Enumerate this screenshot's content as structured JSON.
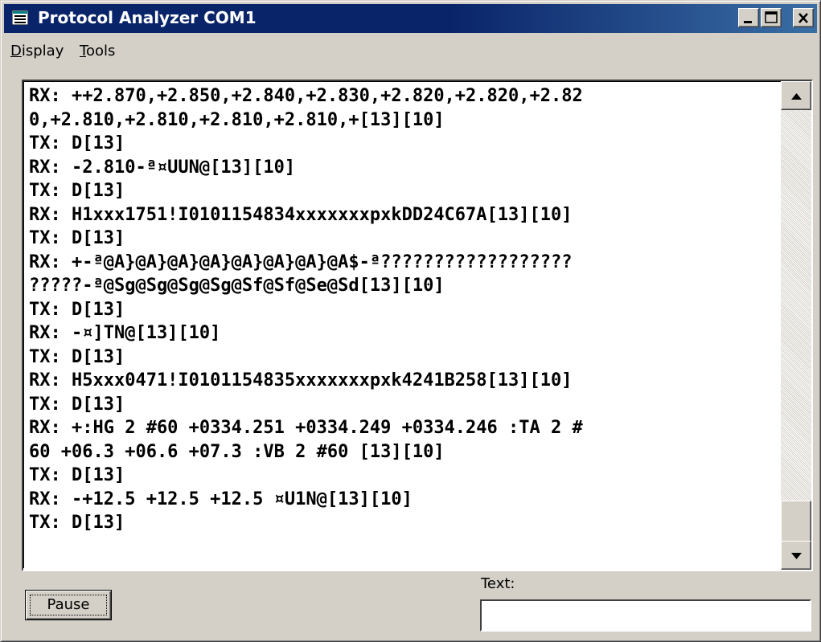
{
  "window": {
    "title": "Protocol Analyzer COM1",
    "icon": "list-window-icon",
    "controls": [
      "minimize-icon",
      "maximize-icon",
      "close-icon"
    ]
  },
  "menubar": {
    "items": [
      {
        "label_first": "D",
        "label_rest": "isplay"
      },
      {
        "label_first": "T",
        "label_rest": "ools"
      }
    ]
  },
  "log": {
    "lines": [
      "RX: ++2.870,+2.850,+2.840,+2.830,+2.820,+2.820,+2.82",
      "0,+2.810,+2.810,+2.810,+2.810,+[13][10]",
      "TX: D[13]",
      "RX: -2.810-ª¤UUN@[13][10]",
      "TX: D[13]",
      "RX: H1xxx1751!I0101154834xxxxxxxpxkDD24C67A[13][10]",
      "TX: D[13]",
      "RX: +-ª@A}@A}@A}@A}@A}@A}@A}@A$-ª??????????????????",
      "?????-ª@Sg@Sg@Sg@Sg@Sf@Sf@Se@Sd[13][10]",
      "TX: D[13]",
      "RX: -¤]TN@[13][10]",
      "TX: D[13]",
      "RX: H5xxx0471!I0101154835xxxxxxxpxk4241B258[13][10]",
      "TX: D[13]",
      "RX: +:HG 2 #60 +0334.251 +0334.249 +0334.246 :TA 2 #",
      "60 +06.3 +06.6 +07.3 :VB 2 #60 [13][10]",
      "TX: D[13]",
      "RX: -+12.5 +12.5 +12.5 ¤U1N@[13][10]",
      "TX: D[13]"
    ]
  },
  "controls": {
    "pause_label": "Pause",
    "text_label": "Text:",
    "text_value": ""
  },
  "colors": {
    "titlebar_start": "#0a246a",
    "titlebar_end": "#3a6ea5",
    "face": "#d4d0c8"
  }
}
